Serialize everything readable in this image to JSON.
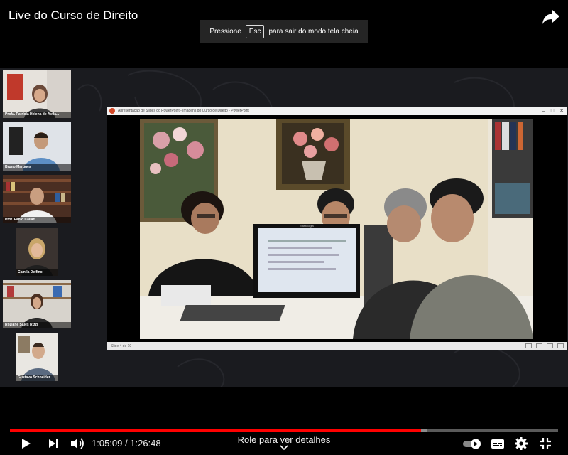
{
  "video": {
    "title": "Live do Curso de Direito",
    "fullscreen_hint": {
      "before": "Pressione",
      "key": "Esc",
      "after": "para sair do modo tela cheia"
    }
  },
  "participants": [
    {
      "name": "Profa. Patrícia Helena de Ávila..."
    },
    {
      "name": "Bruno Marques"
    },
    {
      "name": "Prof. Fábio Callari"
    },
    {
      "name": "Camila Delfino"
    },
    {
      "name": "Roziane Sales Rizzi"
    },
    {
      "name": "Gustavo Schneider Nunes"
    }
  ],
  "presentation": {
    "window_title": "Apresentação de Slides do PowerPoint  -  Imagens do Curso de Direito - PowerPoint",
    "slide_status": "Slide 4 de 10",
    "monitor_label": "Mastologia"
  },
  "player": {
    "current_time": "1:05:09",
    "duration": "1:26:48",
    "time_separator": "/",
    "progress_fraction": 0.75,
    "buffer_fraction": 0.76,
    "details_hint": "Role para ver detalhes"
  },
  "colors": {
    "progress": "#ff0000",
    "background": "#000000",
    "stage": "#1a1b1f"
  },
  "icons": [
    "share-icon",
    "play-icon",
    "next-icon",
    "volume-icon",
    "autoplay-toggle-icon",
    "subtitles-icon",
    "settings-icon",
    "exit-fullscreen-icon",
    "chevron-down-icon"
  ]
}
